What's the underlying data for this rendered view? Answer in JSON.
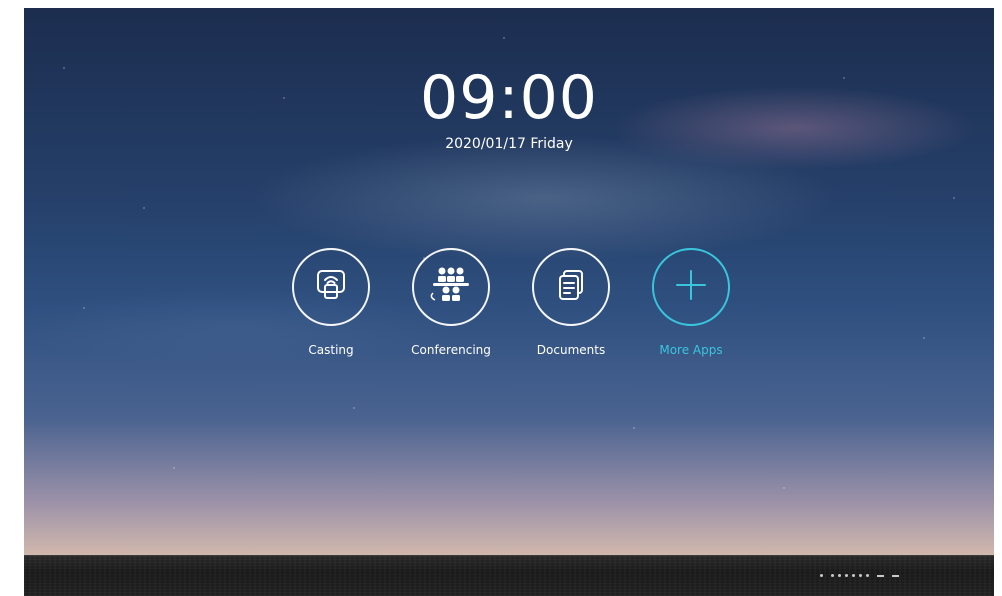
{
  "home": {
    "time": "09:00",
    "date": "2020/01/17 Friday"
  },
  "apps": [
    {
      "label": "Casting",
      "icon": "cast-screen-icon"
    },
    {
      "label": "Conferencing",
      "icon": "conference-people-icon"
    },
    {
      "label": "Documents",
      "icon": "documents-icon"
    },
    {
      "label": "More Apps",
      "icon": "plus-icon"
    }
  ],
  "colors": {
    "accent": "#39c6dc",
    "text": "#ffffff",
    "bezel": "#1f1f1f"
  },
  "bezel": {
    "indicators": [
      "status-dot",
      "status-dot",
      "status-dot",
      "status-dot",
      "status-dot",
      "status-dot",
      "status-dot",
      "status-dash",
      "status-dash"
    ]
  }
}
